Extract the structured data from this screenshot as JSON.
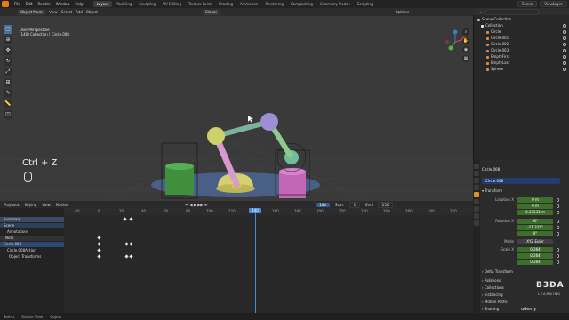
{
  "menu": {
    "items": [
      "File",
      "Edit",
      "Render",
      "Window",
      "Help"
    ]
  },
  "workspaces": [
    "Layout",
    "Modeling",
    "Sculpting",
    "UV Editing",
    "Texture Paint",
    "Shading",
    "Animation",
    "Rendering",
    "Compositing",
    "Geometry Nodes",
    "Scripting"
  ],
  "scene_field": "Scene",
  "viewlayer_field": "ViewLayer",
  "viewport": {
    "mode": "Object Mode",
    "menus": [
      "View",
      "Select",
      "Add",
      "Object"
    ],
    "orientation": "Global",
    "overlay_label": "Options",
    "info_line1": "User Perspective",
    "info_line2": "(140) Collection | Circle.008",
    "shortcut_text": "Ctrl + Z"
  },
  "timeline": {
    "menus": [
      "Playback",
      "Keying",
      "View",
      "Marker"
    ],
    "current_frame": "140",
    "start_label": "Start",
    "start_value": "1",
    "end_label": "End",
    "end_value": "250",
    "ticks": [
      "-20",
      "0",
      "20",
      "40",
      "60",
      "80",
      "100",
      "120",
      "140",
      "160",
      "180",
      "200",
      "220",
      "240",
      "260",
      "280",
      "300",
      "320"
    ],
    "channels": [
      "Summary",
      "Scene",
      "Annotations",
      "Note",
      "Circle.008",
      "Circle.008Action",
      "Object Transforms"
    ]
  },
  "status": {
    "items": [
      "Select",
      "Rotate View",
      "Object"
    ]
  },
  "outliner": {
    "title": "Scene Collection",
    "rows": [
      {
        "label": "Scene Collection",
        "color": "#bbbbbb"
      },
      {
        "label": "Collection",
        "color": "#e6e6e6"
      },
      {
        "label": "Circle",
        "color": "#e08a3c"
      },
      {
        "label": "Circle.001",
        "color": "#e08a3c"
      },
      {
        "label": "Circle.002",
        "color": "#e08a3c"
      },
      {
        "label": "Circle.003",
        "color": "#e08a3c"
      },
      {
        "label": "EmptyFirst",
        "color": "#e08a3c"
      },
      {
        "label": "EmptyLast",
        "color": "#e08a3c"
      },
      {
        "label": "Sphere",
        "color": "#e08a3c"
      }
    ]
  },
  "properties": {
    "object_title": "Circle.008",
    "object_name": "Circle.008",
    "transform_section": "Transform",
    "location_label": "Location X",
    "location": [
      "0 m",
      "0 m",
      "0.33231 m"
    ],
    "rotation_label": "Rotation X",
    "rotation": [
      "90°",
      "-11.333°",
      "0°"
    ],
    "mode_label": "Mode",
    "mode_value": "XYZ Euler",
    "scale_label": "Scale X",
    "scale": [
      "0.264",
      "0.264",
      "0.264"
    ],
    "sections": [
      "Delta Transform",
      "Relations",
      "Collections",
      "Instancing",
      "Motion Paths",
      "Shading"
    ]
  },
  "branding": {
    "logo_text": "B3DA",
    "logo_sub": "LEARNING",
    "watermark": "udemy"
  }
}
